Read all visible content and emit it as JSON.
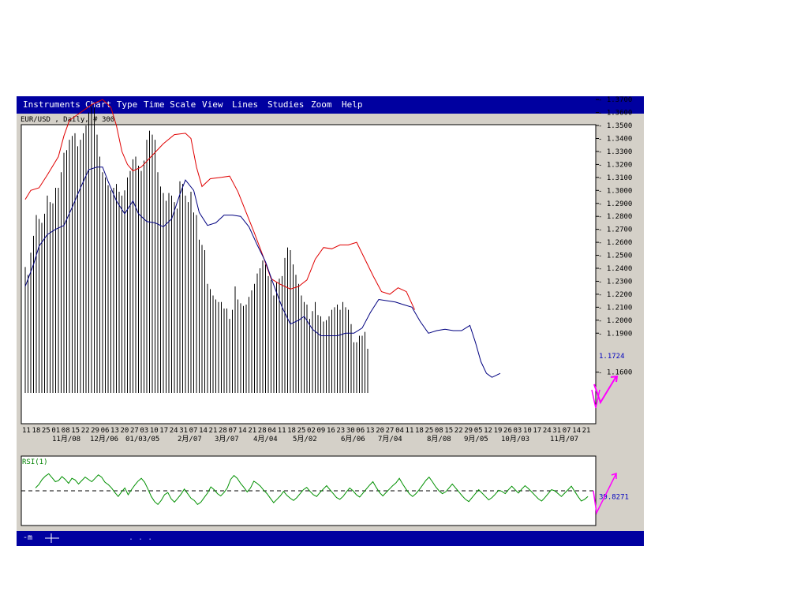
{
  "menu": {
    "items": [
      {
        "id": "instruments",
        "label": "Instruments"
      },
      {
        "id": "chart-type",
        "label": "Chart Type"
      },
      {
        "id": "time-scale",
        "label": "Time Scale"
      },
      {
        "id": "view",
        "label": "View"
      },
      {
        "id": "lines",
        "label": "Lines"
      },
      {
        "id": "studies",
        "label": "Studies"
      },
      {
        "id": "zoom",
        "label": "Zoom"
      },
      {
        "id": "help",
        "label": "Help"
      }
    ]
  },
  "chart_header": "EUR/USD , Daily, # 300",
  "status": {
    "left_label": "-m",
    "cross_icon": "crosshair-icon",
    "dots": ". . ."
  },
  "colors": {
    "menubar": "#0000a0",
    "bollinger": "#e00000",
    "moving_average": "#000080",
    "bars": "#000000",
    "rsi": "#009000",
    "annotation": "#ff00ff",
    "value_label": "#0000c0"
  },
  "chart_data": [
    {
      "type": "bar",
      "subtype": "ohlc_bars_with_bands",
      "title": "EUR/USD , Daily, # 300",
      "xlabel": "",
      "ylabel": "",
      "ylim": [
        1.15,
        1.38
      ],
      "yticks": [
        "1.3700",
        "1.3600",
        "1.3500",
        "1.3400",
        "1.3300",
        "1.3200",
        "1.3100",
        "1.3000",
        "1.2900",
        "1.2800",
        "1.2700",
        "1.2600",
        "1.2500",
        "1.2400",
        "1.2300",
        "1.2200",
        "1.2100",
        "1.2000",
        "1.1900",
        "1.1600"
      ],
      "day_ticks": [
        "11",
        "18",
        "25",
        "01",
        "08",
        "15",
        "22",
        "29",
        "06",
        "13",
        "20",
        "27",
        "03",
        "10",
        "17",
        "24",
        "31",
        "07",
        "14",
        "21",
        "28",
        "07",
        "14",
        "21",
        "28",
        "04",
        "11",
        "18",
        "25",
        "02",
        "09",
        "16",
        "23",
        "30",
        "06",
        "13",
        "20",
        "27",
        "04",
        "11",
        "18",
        "25",
        "08",
        "15",
        "22",
        "29",
        "05",
        "12",
        "19",
        "26",
        "03",
        "10",
        "17",
        "24",
        "31",
        "07",
        "14",
        "21"
      ],
      "month_ticks": [
        "11月/08",
        "12月/06",
        "01/03/05",
        "2月/07",
        "3月/07",
        "4月/04",
        "5月/02",
        "6月/06",
        "7月/04",
        "8月/08",
        "9月/05",
        "10月/03",
        "11月/07"
      ],
      "last_price_label": "1.1724",
      "grid": false,
      "series": [
        {
          "name": "",
          "role": "highs",
          "values": [
            1.241,
            1.235,
            1.252,
            1.265,
            1.281,
            1.278,
            1.275,
            1.282,
            1.296,
            1.291,
            1.29,
            1.302,
            1.302,
            1.314,
            1.329,
            1.331,
            1.339,
            1.342,
            1.344,
            1.334,
            1.339,
            1.344,
            1.35,
            1.36,
            1.366,
            1.364,
            1.343,
            1.326,
            1.314,
            1.31,
            1.304,
            1.3,
            1.302,
            1.305,
            1.299,
            1.296,
            1.3,
            1.31,
            1.315,
            1.324,
            1.326,
            1.319,
            1.315,
            1.323,
            1.339,
            1.346,
            1.343,
            1.339,
            1.314,
            1.303,
            1.298,
            1.292,
            1.298,
            1.296,
            1.291,
            1.286,
            1.307,
            1.305,
            1.296,
            1.291,
            1.299,
            1.283,
            1.281,
            1.262,
            1.258,
            1.254,
            1.228,
            1.224,
            1.219,
            1.216,
            1.214,
            1.214,
            1.209,
            1.209,
            1.201,
            1.208,
            1.226,
            1.216,
            1.213,
            1.211,
            1.212,
            1.218,
            1.223,
            1.228,
            1.236,
            1.24,
            1.246,
            1.243,
            1.234,
            1.231,
            1.219,
            1.229,
            1.232,
            1.234,
            1.248,
            1.256,
            1.254,
            1.243,
            1.235,
            1.228,
            1.219,
            1.214,
            1.212,
            1.201,
            1.207,
            1.214,
            1.204,
            1.203,
            1.199,
            1.2,
            1.203,
            1.208,
            1.21,
            1.212,
            1.208,
            1.214,
            1.21,
            1.208,
            1.197,
            1.183,
            1.183,
            1.188,
            1.188,
            1.191,
            1.178
          ]
        },
        {
          "name": "",
          "role": "bollinger_upper",
          "values": [
            [
              0,
              1.293
            ],
            [
              2,
              1.3
            ],
            [
              5,
              1.302
            ],
            [
              8,
              1.312
            ],
            [
              12,
              1.326
            ],
            [
              14,
              1.342
            ],
            [
              16,
              1.354
            ],
            [
              20,
              1.36
            ],
            [
              24,
              1.366
            ],
            [
              28,
              1.37
            ],
            [
              31,
              1.364
            ],
            [
              33,
              1.35
            ],
            [
              35,
              1.33
            ],
            [
              37,
              1.32
            ],
            [
              39,
              1.315
            ],
            [
              42,
              1.318
            ],
            [
              46,
              1.327
            ],
            [
              50,
              1.336
            ],
            [
              54,
              1.343
            ],
            [
              58,
              1.344
            ],
            [
              60,
              1.34
            ],
            [
              62,
              1.318
            ],
            [
              64,
              1.303
            ],
            [
              67,
              1.309
            ],
            [
              71,
              1.31
            ],
            [
              74,
              1.311
            ],
            [
              77,
              1.299
            ],
            [
              80,
              1.283
            ],
            [
              83,
              1.267
            ],
            [
              86,
              1.25
            ],
            [
              89,
              1.232
            ],
            [
              92,
              1.228
            ],
            [
              96,
              1.224
            ],
            [
              99,
              1.226
            ],
            [
              102,
              1.231
            ],
            [
              105,
              1.247
            ],
            [
              108,
              1.256
            ],
            [
              111,
              1.255
            ],
            [
              114,
              1.258
            ],
            [
              117,
              1.258
            ],
            [
              120,
              1.26
            ],
            [
              123,
              1.247
            ],
            [
              126,
              1.234
            ],
            [
              129,
              1.222
            ],
            [
              132,
              1.22
            ],
            [
              135,
              1.225
            ],
            [
              138,
              1.222
            ],
            [
              141,
              1.208
            ]
          ]
        },
        {
          "name": "",
          "role": "moving_average",
          "values": [
            [
              0,
              1.226
            ],
            [
              3,
              1.243
            ],
            [
              5,
              1.257
            ],
            [
              8,
              1.266
            ],
            [
              11,
              1.27
            ],
            [
              14,
              1.273
            ],
            [
              17,
              1.287
            ],
            [
              20,
              1.302
            ],
            [
              23,
              1.316
            ],
            [
              26,
              1.318
            ],
            [
              28,
              1.318
            ],
            [
              30,
              1.307
            ],
            [
              33,
              1.292
            ],
            [
              36,
              1.282
            ],
            [
              39,
              1.292
            ],
            [
              41,
              1.282
            ],
            [
              44,
              1.276
            ],
            [
              47,
              1.275
            ],
            [
              50,
              1.272
            ],
            [
              53,
              1.278
            ],
            [
              56,
              1.297
            ],
            [
              58,
              1.308
            ],
            [
              61,
              1.3
            ],
            [
              63,
              1.283
            ],
            [
              66,
              1.273
            ],
            [
              69,
              1.275
            ],
            [
              72,
              1.281
            ],
            [
              75,
              1.281
            ],
            [
              78,
              1.28
            ],
            [
              81,
              1.272
            ],
            [
              84,
              1.258
            ],
            [
              87,
              1.245
            ],
            [
              90,
              1.227
            ],
            [
              93,
              1.21
            ],
            [
              96,
              1.197
            ],
            [
              99,
              1.2
            ],
            [
              101,
              1.203
            ],
            [
              104,
              1.193
            ],
            [
              107,
              1.188
            ],
            [
              110,
              1.188
            ],
            [
              113,
              1.188
            ],
            [
              116,
              1.19
            ],
            [
              119,
              1.19
            ],
            [
              122,
              1.194
            ],
            [
              125,
              1.206
            ],
            [
              128,
              1.216
            ],
            [
              131,
              1.215
            ],
            [
              134,
              1.214
            ],
            [
              137,
              1.212
            ],
            [
              140,
              1.21
            ],
            [
              143,
              1.199
            ],
            [
              146,
              1.19
            ],
            [
              149,
              1.192
            ],
            [
              152,
              1.193
            ],
            [
              155,
              1.192
            ],
            [
              158,
              1.192
            ],
            [
              161,
              1.196
            ],
            [
              163,
              1.183
            ],
            [
              165,
              1.168
            ],
            [
              167,
              1.159
            ],
            [
              169,
              1.156
            ],
            [
              172,
              1.159
            ]
          ]
        }
      ]
    },
    {
      "type": "line",
      "title": "RSI(1)",
      "ylim": [
        0,
        100
      ],
      "reference_line": 50,
      "last_value_label": "39.8271",
      "series": [
        {
          "name": "",
          "values": [
            55,
            61,
            70,
            76,
            80,
            73,
            66,
            68,
            75,
            70,
            63,
            72,
            69,
            62,
            68,
            74,
            70,
            66,
            72,
            78,
            74,
            65,
            61,
            55,
            47,
            40,
            48,
            55,
            43,
            52,
            60,
            67,
            72,
            65,
            53,
            40,
            31,
            26,
            33,
            43,
            47,
            36,
            30,
            37,
            44,
            53,
            45,
            37,
            33,
            26,
            30,
            38,
            46,
            57,
            52,
            45,
            41,
            47,
            55,
            70,
            77,
            72,
            63,
            56,
            48,
            55,
            67,
            63,
            58,
            51,
            45,
            37,
            29,
            35,
            41,
            49,
            42,
            37,
            33,
            38,
            45,
            52,
            56,
            49,
            43,
            40,
            47,
            53,
            59,
            52,
            45,
            38,
            35,
            40,
            48,
            55,
            50,
            43,
            39,
            46,
            53,
            60,
            66,
            56,
            47,
            41,
            47,
            53,
            59,
            64,
            72,
            62,
            53,
            45,
            40,
            45,
            52,
            60,
            68,
            74,
            66,
            57,
            50,
            45,
            48,
            55,
            62,
            55,
            48,
            41,
            35,
            31,
            38,
            45,
            52,
            46,
            40,
            34,
            38,
            44,
            51,
            49,
            45,
            52,
            58,
            52,
            46,
            53,
            59,
            54,
            48,
            42,
            36,
            32,
            38,
            45,
            52,
            50,
            45,
            40,
            46,
            52,
            58,
            49,
            40,
            32,
            35,
            40
          ]
        }
      ]
    }
  ]
}
